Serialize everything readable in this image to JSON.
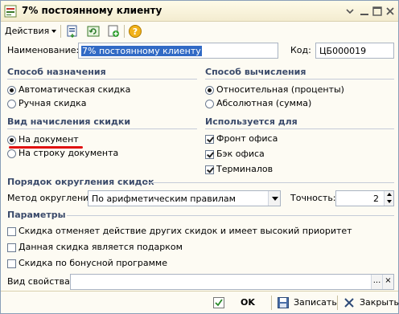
{
  "window": {
    "title": "7% постоянному клиенту",
    "app_icon": "1c-app-icon",
    "controls": [
      "window-menu-icon",
      "minimize-icon",
      "maximize-icon",
      "close-icon"
    ]
  },
  "toolbar": {
    "actions_label": "Действия",
    "icons": [
      "save-to-parent-icon",
      "refresh-icon",
      "add-copy-icon",
      "help-icon"
    ]
  },
  "name": {
    "label": "Наименование:",
    "value": "7% постоянному клиенту"
  },
  "code": {
    "label": "Код:",
    "value": "ЦБ000019"
  },
  "assign_method": {
    "title": "Способ назначения",
    "options": [
      "Автоматическая скидка",
      "Ручная скидка"
    ],
    "selected": 0
  },
  "calc_method": {
    "title": "Способ вычисления",
    "options": [
      "Относительная (проценты)",
      "Абсолютная (сумма)"
    ],
    "selected": 0
  },
  "accrual_type": {
    "title": "Вид начисления скидки",
    "options": [
      "На документ",
      "На строку документа"
    ],
    "selected": 0
  },
  "used_for": {
    "title": "Используется для",
    "items": [
      {
        "label": "Фронт офиса",
        "checked": true
      },
      {
        "label": "Бэк офиса",
        "checked": true
      },
      {
        "label": "Терминалов",
        "checked": true
      }
    ]
  },
  "rounding": {
    "title": "Порядок округления скидок",
    "method_label": "Метод округления:",
    "method_value": "По арифметическим правилам",
    "precision_label": "Точность:",
    "precision_value": "2"
  },
  "params": {
    "title": "Параметры",
    "items": [
      {
        "label": "Скидка отменяет действие других скидок и имеет высокий приоритет",
        "checked": false
      },
      {
        "label": "Данная скидка является подарком",
        "checked": false
      },
      {
        "label": "Скидка по бонусной программе",
        "checked": false
      }
    ]
  },
  "property_kind": {
    "label": "Вид свойства:",
    "value": "",
    "ellipsis": "...",
    "clear": "×"
  },
  "footer": {
    "ok": "OK",
    "save": "Записать",
    "close": "Закрыть"
  },
  "colors": {
    "section_title": "#3b4b6b",
    "selection": "#316ac5",
    "annotation_line": "#e01010"
  }
}
